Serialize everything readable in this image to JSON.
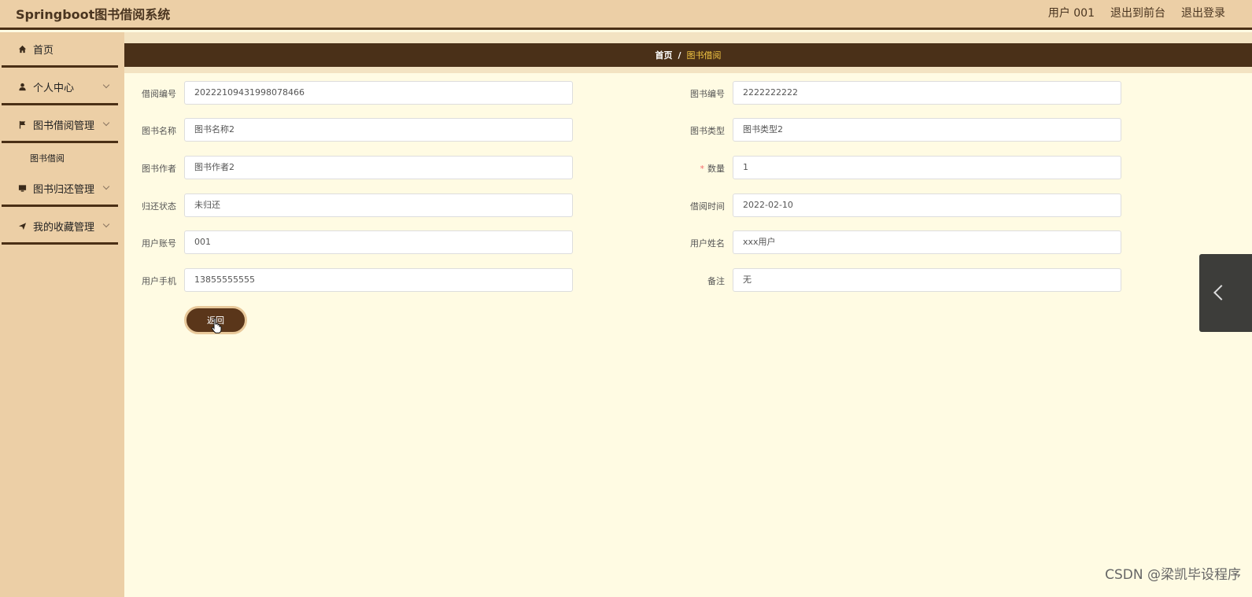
{
  "header": {
    "title": "Springboot图书借阅系统",
    "user_label": "用户 001",
    "exit_front": "退出到前台",
    "logout": "退出登录"
  },
  "sidebar": {
    "items": [
      {
        "label": "首页",
        "icon": "home-icon"
      },
      {
        "label": "个人中心",
        "icon": "user-icon"
      },
      {
        "label": "图书借阅管理",
        "icon": "flag-icon"
      },
      {
        "label": "图书归还管理",
        "icon": "monitor-icon"
      },
      {
        "label": "我的收藏管理",
        "icon": "send-icon"
      }
    ],
    "sub_item": "图书借阅"
  },
  "breadcrumb": {
    "home": "首页",
    "separator": "/",
    "current": "图书借阅"
  },
  "form": {
    "borrow_no_label": "借阅编号",
    "borrow_no": "20222109431998078466",
    "book_no_label": "图书编号",
    "book_no": "2222222222",
    "book_name_label": "图书名称",
    "book_name": "图书名称2",
    "book_type_label": "图书类型",
    "book_type": "图书类型2",
    "author_label": "图书作者",
    "author": "图书作者2",
    "quantity_label": "数量",
    "required_mark": "*",
    "quantity": "1",
    "return_status_label": "归还状态",
    "return_status": "未归还",
    "borrow_time_label": "借阅时间",
    "borrow_time": "2022-02-10",
    "account_label": "用户账号",
    "account": "001",
    "user_name_label": "用户姓名",
    "user_name": "xxx用户",
    "phone_label": "用户手机",
    "phone": "13855555555",
    "remark_label": "备注",
    "remark": "无",
    "back_button": "返回"
  },
  "watermark": "CSDN @梁凯毕设程序",
  "colors": {
    "header_bg": "#eccfa6",
    "dark_brown": "#4a3018",
    "content_bg": "#fffbe3",
    "crumb_active": "#f1c542"
  }
}
